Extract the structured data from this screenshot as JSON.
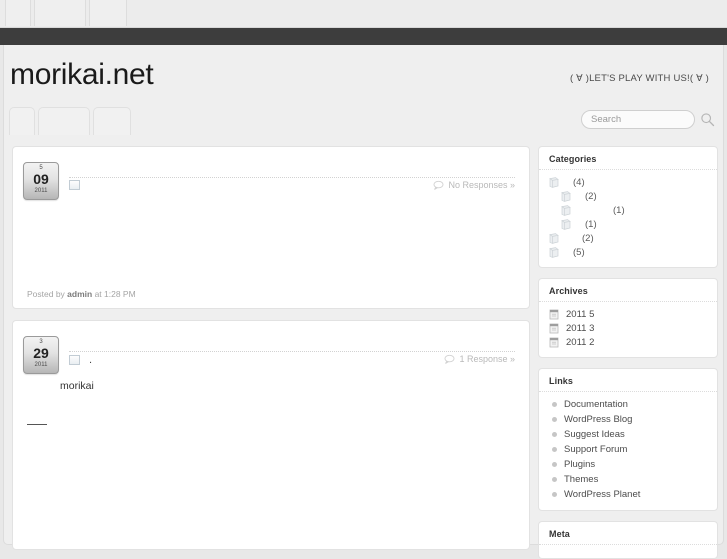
{
  "browser": {
    "top_tabs": [
      "",
      "",
      ""
    ]
  },
  "site": {
    "title": "morikai.net",
    "tagline": "( ∀ )LET'S PLAY WITH US!( ∀ )"
  },
  "nav": {
    "items": [
      "",
      "",
      ""
    ]
  },
  "search": {
    "placeholder": "Search",
    "value": "",
    "icon": "search-icon"
  },
  "posts": [
    {
      "date": {
        "month": "5",
        "day": "09",
        "year": "2011"
      },
      "title": "",
      "title_icon": "broken-image-icon",
      "comments": "No Responses »",
      "comments_icon": "comment-bubble-icon",
      "body": "",
      "meta_prefix": "Posted by ",
      "meta_author": "admin",
      "meta_suffix": " at 1:28 PM"
    },
    {
      "date": {
        "month": "3",
        "day": "29",
        "year": "2011"
      },
      "title": ".",
      "title_icon": "broken-image-icon",
      "comments": "1 Response »",
      "comments_icon": "comment-bubble-icon",
      "body": "morikai",
      "meta_prefix": "",
      "meta_author": "",
      "meta_suffix": ""
    }
  ],
  "sidebar": {
    "categories": {
      "title": "Categories",
      "items": [
        {
          "name": "",
          "count": "(4)",
          "indent": 0,
          "icon": "book-icon"
        },
        {
          "name": "",
          "count": "(2)",
          "indent": 1,
          "icon": "book-icon"
        },
        {
          "name": "",
          "count": "(1)",
          "indent": 1,
          "icon": "book-icon"
        },
        {
          "name": "",
          "count": "(1)",
          "indent": 1,
          "icon": "book-icon"
        },
        {
          "name": "",
          "count": "(2)",
          "indent": 0,
          "icon": "book-icon"
        },
        {
          "name": "",
          "count": "(5)",
          "indent": 0,
          "icon": "book-icon"
        }
      ]
    },
    "archives": {
      "title": "Archives",
      "items": [
        {
          "label": "2011 5",
          "icon": "calendar-icon"
        },
        {
          "label": "2011 3",
          "icon": "calendar-icon"
        },
        {
          "label": "2011 2",
          "icon": "calendar-icon"
        }
      ]
    },
    "links": {
      "title": "Links",
      "items": [
        {
          "label": "Documentation"
        },
        {
          "label": "WordPress Blog"
        },
        {
          "label": "Suggest Ideas"
        },
        {
          "label": "Support Forum"
        },
        {
          "label": "Plugins"
        },
        {
          "label": "Themes"
        },
        {
          "label": "WordPress Planet"
        }
      ]
    },
    "meta": {
      "title": "Meta"
    }
  },
  "colors": {
    "dark_bar": "#3d3d3d",
    "page_bg": "#efefef",
    "widget_bg": "#ffffff",
    "muted_text": "#a5a5a5"
  }
}
